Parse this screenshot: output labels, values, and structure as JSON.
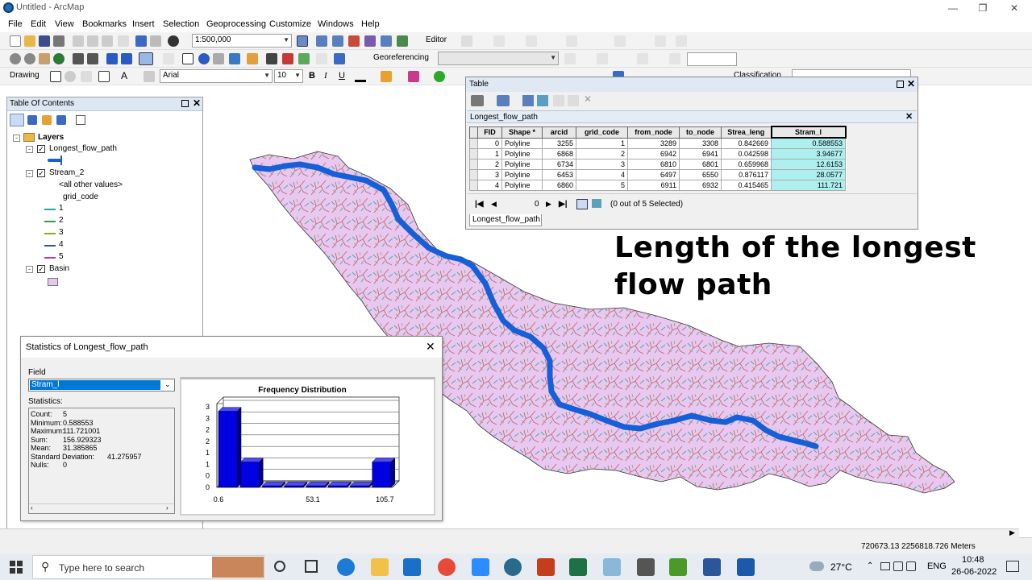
{
  "window": {
    "title": "Untitled - ArcMap"
  },
  "menu": [
    "File",
    "Edit",
    "View",
    "Bookmarks",
    "Insert",
    "Selection",
    "Geoprocessing",
    "Customize",
    "Windows",
    "Help"
  ],
  "toolbar": {
    "scale": "1:500,000",
    "editor": "Editor",
    "georeferencing": "Georeferencing",
    "drawing": "Drawing",
    "font": "Arial",
    "font_size": "10",
    "bold": "B",
    "italic": "I",
    "underline": "U",
    "text_tool": "A",
    "classification": "Classification"
  },
  "toc": {
    "title": "Table Of Contents",
    "layers_label": "Layers",
    "layer1": "Longest_flow_path",
    "layer2": "Stream_2",
    "all_other": "<all other values>",
    "grid_code": "grid_code",
    "classes": [
      "1",
      "2",
      "3",
      "4",
      "5"
    ],
    "class_colors": [
      "#2ca58d",
      "#3a9a3a",
      "#9aa31f",
      "#3450a0",
      "#c03a8a"
    ],
    "layer3": "Basin",
    "basin_color": "#e8c8f0",
    "flowpath_color": "#1560d8"
  },
  "table_window": {
    "title": "Table",
    "layer_tab": "Longest_flow_path",
    "columns": [
      "FID",
      "Shape *",
      "arcid",
      "grid_code",
      "from_node",
      "to_node",
      "Strea_leng",
      "Stram_l"
    ],
    "rows": [
      [
        "0",
        "Polyline",
        "3255",
        "1",
        "3289",
        "3308",
        "0.842669",
        "0.588553"
      ],
      [
        "1",
        "Polyline",
        "6868",
        "2",
        "6942",
        "6941",
        "0.042598",
        "3.94677"
      ],
      [
        "2",
        "Polyline",
        "6734",
        "3",
        "6810",
        "6801",
        "0.659968",
        "12.6153"
      ],
      [
        "3",
        "Polyline",
        "6453",
        "4",
        "6497",
        "6550",
        "0.876117",
        "28.0577"
      ],
      [
        "4",
        "Polyline",
        "6860",
        "5",
        "6911",
        "6932",
        "0.415465",
        "111.721"
      ]
    ],
    "record_index": "0",
    "selection_status": "(0 out of 5 Selected)",
    "bottom_tab": "Longest_flow_path"
  },
  "annotation": {
    "line1": "Length of the longest",
    "line2": "flow path"
  },
  "stats_dialog": {
    "title": "Statistics of Longest_flow_path",
    "field_label": "Field",
    "field_value": "Stram_l",
    "statistics_label": "Statistics:",
    "stats": [
      {
        "k": "Count:",
        "v": "5"
      },
      {
        "k": "Minimum:",
        "v": "0.588553"
      },
      {
        "k": "Maximum:",
        "v": "111.721001"
      },
      {
        "k": "Sum:",
        "v": "156.929323"
      },
      {
        "k": "Mean:",
        "v": "31.385865"
      },
      {
        "k": "Standard Deviation:",
        "v": "41.275957"
      },
      {
        "k": "Nulls:",
        "v": "0"
      }
    ]
  },
  "chart_data": {
    "type": "bar",
    "title": "Frequency Distribution",
    "categories": [
      "0.6",
      "",
      "",
      "",
      "",
      "",
      "",
      "105.7"
    ],
    "x_tick_labels": [
      "0.6",
      "53.1",
      "105.7"
    ],
    "values": [
      3,
      1,
      0,
      0,
      0,
      0,
      0,
      1
    ],
    "y_tick_labels": [
      "3",
      "3",
      "2",
      "2",
      "1",
      "1",
      "0",
      "0"
    ],
    "ylim": [
      0,
      3.3
    ],
    "bar_color": "#0000e0"
  },
  "status": {
    "coords": "720673.13  2256818.726 Meters"
  },
  "taskbar": {
    "search_placeholder": "Type here to search",
    "weather": "27°C",
    "lang": "ENG",
    "time": "10:48",
    "date": "26-06-2022"
  }
}
